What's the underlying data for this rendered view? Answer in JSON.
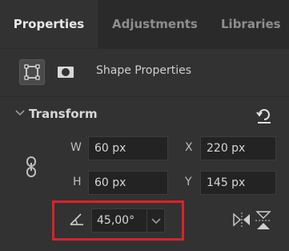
{
  "tabs": [
    {
      "label": "Properties",
      "active": true
    },
    {
      "label": "Adjustments",
      "active": false
    },
    {
      "label": "Libraries",
      "active": false
    }
  ],
  "shape": {
    "title": "Shape Properties",
    "icons": [
      "bounding-box-icon",
      "mask-icon"
    ]
  },
  "transform": {
    "label": "Transform",
    "width_label": "W",
    "width_value": "60 px",
    "height_label": "H",
    "height_value": "60 px",
    "x_label": "X",
    "x_value": "220 px",
    "y_label": "Y",
    "y_value": "145 px",
    "angle_value": "45,00°"
  },
  "colors": {
    "panel_bg": "#323232",
    "tabbar_bg": "#2a2a2a",
    "field_bg": "#232323",
    "highlight_red": "#d8232a"
  }
}
